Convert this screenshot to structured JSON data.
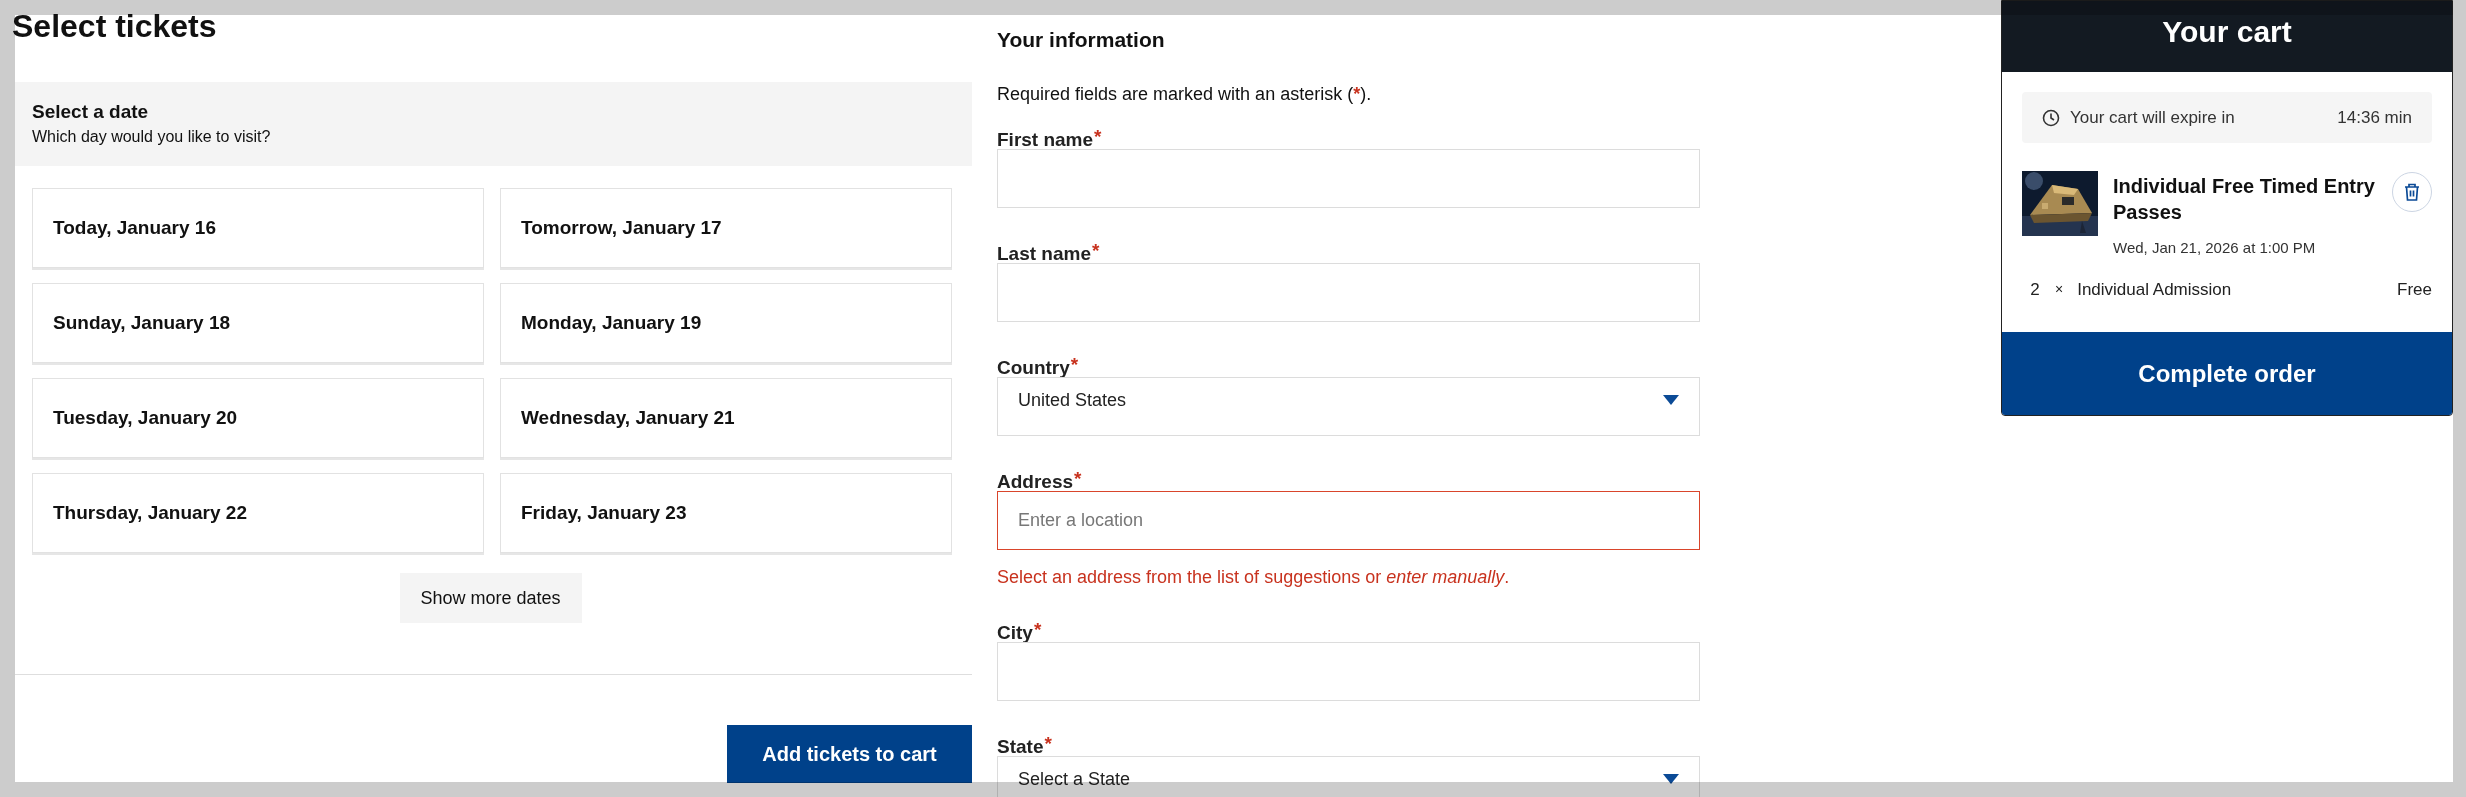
{
  "tickets": {
    "title": "Select tickets",
    "date_panel": {
      "title": "Select a date",
      "subtitle": "Which day would you like to visit?"
    },
    "dates": [
      {
        "label": "Today, January 16"
      },
      {
        "label": "Tomorrow, January 17"
      },
      {
        "label": "Sunday, January 18"
      },
      {
        "label": "Monday, January 19"
      },
      {
        "label": "Tuesday, January 20"
      },
      {
        "label": "Wednesday, January 21"
      },
      {
        "label": "Thursday, January 22"
      },
      {
        "label": "Friday, January 23"
      }
    ],
    "more_button": "Show more dates",
    "add_button": "Add tickets to cart"
  },
  "form": {
    "title": "Your information",
    "required_note": {
      "before": "Required fields are marked with an asterisk (",
      "mark": "*",
      "after": ")."
    },
    "fields": [
      {
        "kind": "text",
        "label": "First name",
        "mark": "*",
        "invalid": false
      },
      {
        "kind": "text",
        "label": "Last name",
        "mark": "*",
        "invalid": false
      },
      {
        "kind": "select",
        "label": "Country",
        "mark": "*",
        "value": "United States",
        "invalid": false
      },
      {
        "kind": "text",
        "label": "Address",
        "mark": "*",
        "placeholder": "Enter a location",
        "invalid": true,
        "error": "Select an address from the list of suggestions or *enter manually*."
      },
      {
        "kind": "text",
        "label": "City",
        "mark": "*",
        "invalid": false
      },
      {
        "kind": "select",
        "label": "State",
        "mark": "*",
        "value": "Select a State",
        "invalid": false
      }
    ]
  },
  "cart": {
    "title": "Your cart",
    "expiry": {
      "label": "Your cart will expire in",
      "time": "14:36 min"
    },
    "item": {
      "title": "Individual Free Timed Entry Passes",
      "date": "Wed, Jan 21, 2026 at 1:00 PM"
    },
    "lines": [
      {
        "qty": "2",
        "sign": "×",
        "name": "Individual Admission",
        "price": "Free"
      }
    ],
    "button": "Complete order"
  }
}
